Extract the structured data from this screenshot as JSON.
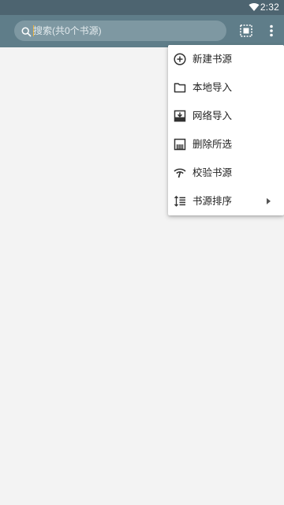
{
  "status_bar": {
    "time": "2:32",
    "icons": [
      "wifi-icon"
    ]
  },
  "search": {
    "placeholder": "搜索(共0个书源)",
    "value": ""
  },
  "toolbar": {
    "icons": [
      "select-all-icon",
      "more-vert-icon"
    ]
  },
  "menu": {
    "items": [
      {
        "label": "新建书源",
        "icon": "add-circle-icon"
      },
      {
        "label": "本地导入",
        "icon": "folder-icon"
      },
      {
        "label": "网络导入",
        "icon": "download-icon"
      },
      {
        "label": "删除所选",
        "icon": "delete-select-icon"
      },
      {
        "label": "校验书源",
        "icon": "signal-check-icon"
      },
      {
        "label": "书源排序",
        "icon": "sort-icon",
        "has_submenu": true
      }
    ]
  },
  "colors": {
    "status_bar": "#4d6470",
    "app_bar": "#5f7d89",
    "search_box": "#7e98a2",
    "background": "#f3f3f3",
    "menu_bg": "#ffffff",
    "cursor": "#f2b53a"
  }
}
